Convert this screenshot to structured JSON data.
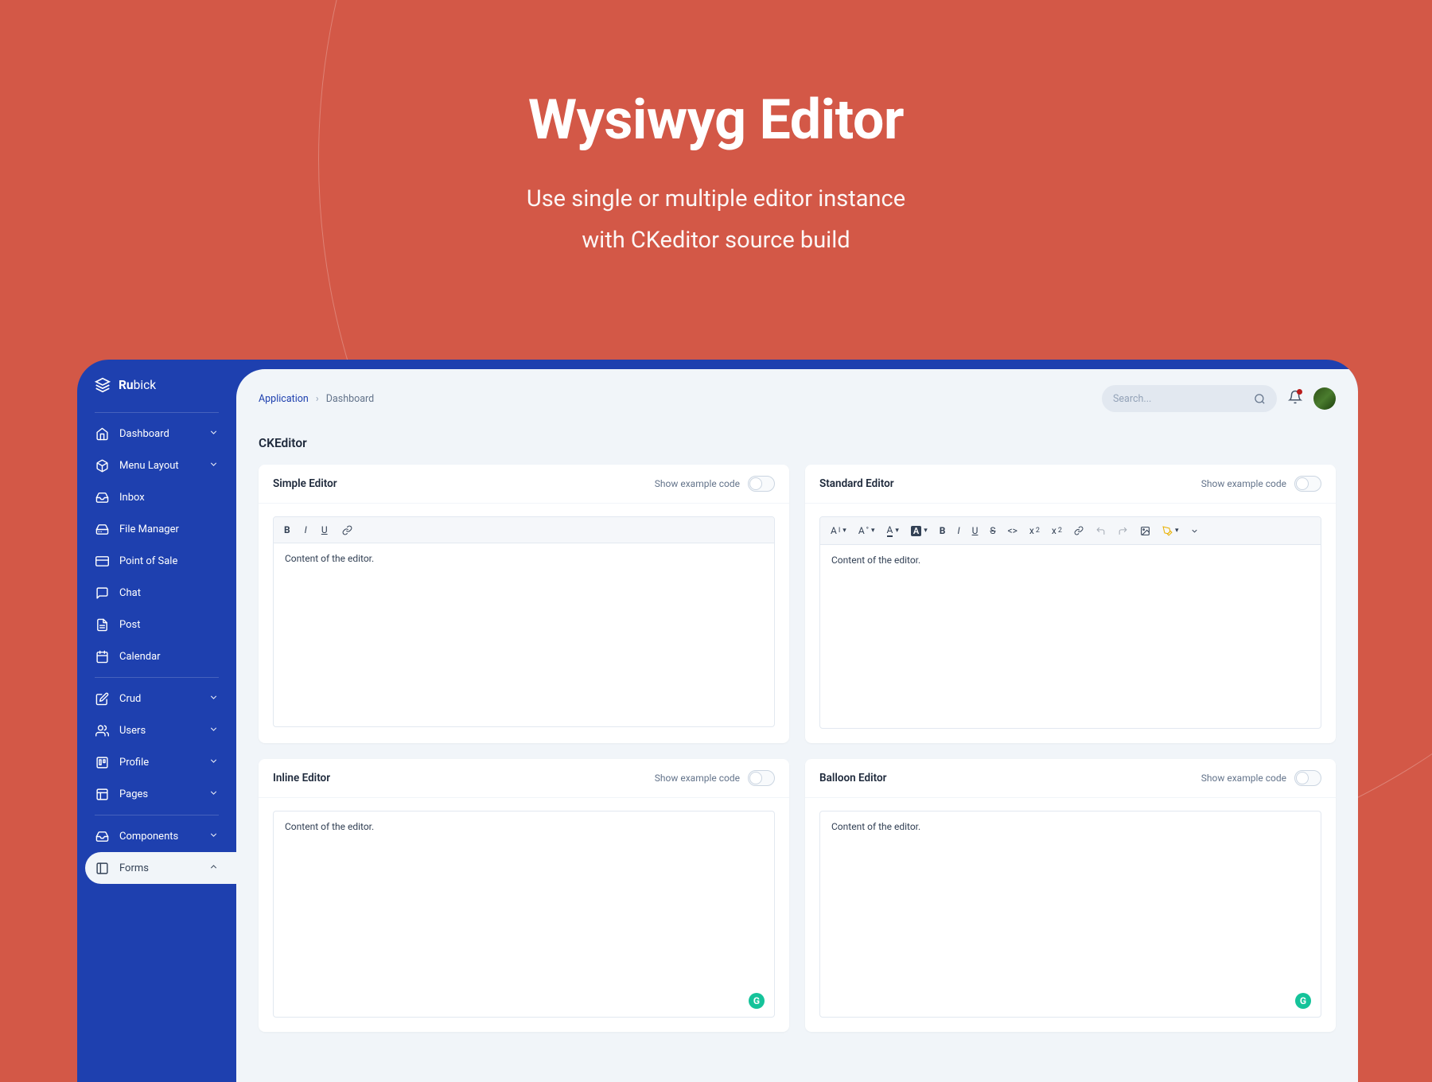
{
  "hero": {
    "title": "Wysiwyg Editor",
    "subtitle_line1": "Use single or multiple editor instance",
    "subtitle_line2": "with CKeditor source build"
  },
  "brand": {
    "prefix": "Ru",
    "suffix": "bick"
  },
  "sidebar": {
    "group1": [
      {
        "label": "Dashboard",
        "icon": "home",
        "chevron": true
      },
      {
        "label": "Menu Layout",
        "icon": "box",
        "chevron": true
      },
      {
        "label": "Inbox",
        "icon": "inbox",
        "chevron": false
      },
      {
        "label": "File Manager",
        "icon": "harddrive",
        "chevron": false
      },
      {
        "label": "Point of Sale",
        "icon": "creditcard",
        "chevron": false
      },
      {
        "label": "Chat",
        "icon": "message",
        "chevron": false
      },
      {
        "label": "Post",
        "icon": "filetext",
        "chevron": false
      },
      {
        "label": "Calendar",
        "icon": "calendar",
        "chevron": false
      }
    ],
    "group2": [
      {
        "label": "Crud",
        "icon": "edit",
        "chevron": true
      },
      {
        "label": "Users",
        "icon": "users",
        "chevron": true
      },
      {
        "label": "Profile",
        "icon": "trello",
        "chevron": true
      },
      {
        "label": "Pages",
        "icon": "layout",
        "chevron": true
      }
    ],
    "group3": [
      {
        "label": "Components",
        "icon": "inbox",
        "chevron": true
      },
      {
        "label": "Forms",
        "icon": "sidebar",
        "chevron": true,
        "active": true
      }
    ]
  },
  "breadcrumb": {
    "root": "Application",
    "current": "Dashboard"
  },
  "search": {
    "placeholder": "Search..."
  },
  "section": {
    "title": "CKEditor"
  },
  "toggle_label": "Show example code",
  "cards": {
    "simple": {
      "title": "Simple Editor",
      "content": "Content of the editor."
    },
    "standard": {
      "title": "Standard Editor",
      "content": "Content of the editor."
    },
    "inline": {
      "title": "Inline Editor",
      "content": "Content of the editor."
    },
    "balloon": {
      "title": "Balloon Editor",
      "content": "Content of the editor."
    }
  },
  "simple_toolbar": [
    "bold",
    "italic",
    "underline",
    "link"
  ],
  "standard_toolbar": [
    "heading",
    "fontfamily",
    "fontsize",
    "fontcolor",
    "highlight",
    "bold",
    "italic",
    "underline",
    "strike",
    "code",
    "subscript",
    "superscript",
    "link",
    "undo",
    "redo",
    "image",
    "marker",
    "more"
  ]
}
